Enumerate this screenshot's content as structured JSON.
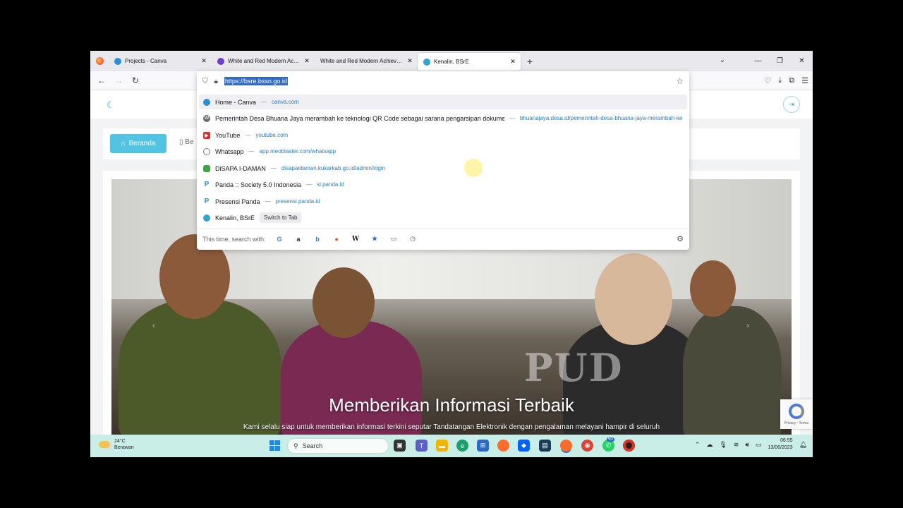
{
  "browser": {
    "tabs": [
      {
        "title": "Projects - Canva",
        "color": "#2b8fd6",
        "active": false
      },
      {
        "title": "White and Red Modern Achieveme",
        "color": "#6b3fc9",
        "active": false
      },
      {
        "title": "White and Red Modern Achieveme",
        "color": "",
        "active": false
      },
      {
        "title": "Kenalin, BSrE",
        "color": "#2fa6cf",
        "active": true
      }
    ],
    "url": "https://bsre.bssn.go.id"
  },
  "suggestions": [
    {
      "title": "Home - Canva",
      "url": "canva.com",
      "color": "#2b8fd6",
      "highlighted": true
    },
    {
      "title": "Pemerintah Desa Bhuana Jaya merambah ke teknologi QR Code sebagai sarana pengarsipan dokume",
      "url": "bhuanajaya.desa.id/pemerintah-desa-bhuana-jaya-merambah-ke",
      "color": "#6a6a6a"
    },
    {
      "title": "YouTube",
      "url": "youtube.com",
      "color": "#e52d27"
    },
    {
      "title": "Whatsapp",
      "url": "app.meoblaster.com/whatsapp",
      "color": "#888"
    },
    {
      "title": "DiSAPA I-DAMAN",
      "url": "disapaidaman.kukarkab.go.id/admin/login",
      "color": "#3da83d"
    },
    {
      "title": "Panda :: Society 5.0 Indonesia",
      "url": "si.panda.id",
      "color": "#2b8fd6"
    },
    {
      "title": "Presensi Panda",
      "url": "presensi.panda.id",
      "color": "#2b8fd6"
    },
    {
      "title": "Kenalin, BSrE",
      "url": "",
      "color": "#2fa6cf",
      "action": "Switch to Tab"
    }
  ],
  "search_with_label": "This time, search with:",
  "page": {
    "menu_active": "Beranda",
    "menu_next": "Be",
    "watermark": "PUD",
    "hero_title": "Memberikan Informasi Terbaik",
    "hero_subtitle": "Kami selalu siap untuk memberikan informasi terkini seputar Tandatangan Elektronik dengan pengalaman melayani hampir di seluruh",
    "recaptcha_text": "Privacy - Terms"
  },
  "taskbar": {
    "temperature": "24°C",
    "weather": "Berawan",
    "search_placeholder": "Search",
    "badge": "50",
    "time": "06:55",
    "date": "13/06/2023"
  }
}
